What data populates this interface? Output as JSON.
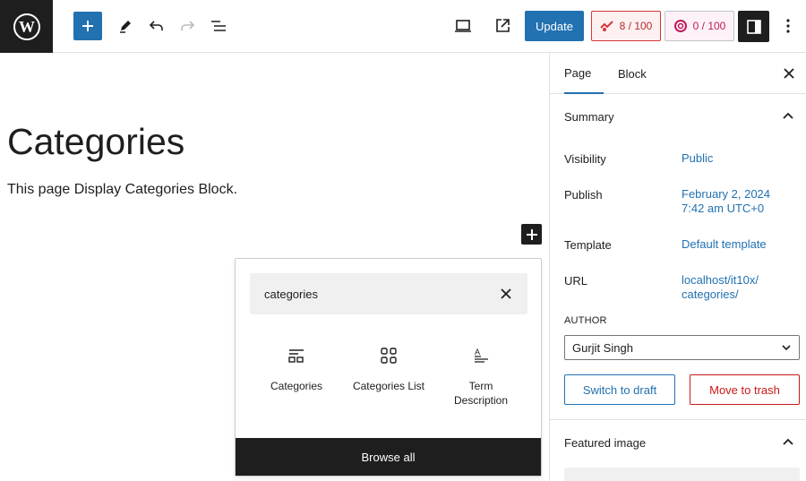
{
  "toolbar": {
    "update_label": "Update",
    "seo_score": "8 / 100",
    "readability_score": "0 / 100"
  },
  "icons": {
    "logo": "wordpress-logo-icon",
    "add": "plus-icon",
    "tools": "pencil-icon",
    "undo": "undo-icon",
    "redo": "redo-icon",
    "list_view": "list-view-icon",
    "preview": "laptop-icon",
    "view_page": "external-link-icon",
    "settings": "sidebar-icon",
    "more": "more-vertical-icon"
  },
  "editor": {
    "title": "Categories",
    "paragraph": "This page Display Categories Block."
  },
  "inserter": {
    "search_value": "categories",
    "blocks": [
      {
        "label": "Categories"
      },
      {
        "label": "Categories List"
      },
      {
        "label": "Term Description"
      }
    ],
    "browse_all": "Browse all"
  },
  "sidebar": {
    "tabs": [
      "Page",
      "Block"
    ],
    "summary_heading": "Summary",
    "rows": [
      {
        "label": "Visibility",
        "value": "Public"
      },
      {
        "label": "Publish",
        "value_line1": "February 2, 2024",
        "value_line2": "7:42 am UTC+0"
      },
      {
        "label": "Template",
        "value": "Default template"
      },
      {
        "label": "URL",
        "value_line1": "localhost/it10x/",
        "value_line2": "categories/"
      }
    ],
    "author_label": "AUTHOR",
    "author_value": "Gurjit Singh",
    "switch_draft": "Switch to draft",
    "move_trash": "Move to trash",
    "featured_image": "Featured image"
  },
  "colors": {
    "accent": "#2271b1",
    "dark": "#1e1e1e",
    "danger": "#cc1818"
  }
}
